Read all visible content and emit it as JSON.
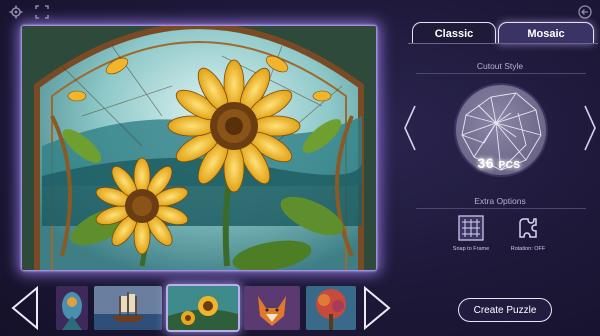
{
  "top_bar": {
    "settings_icon": "gear-icon",
    "fullscreen_icon": "fullscreen-icon",
    "back_icon": "back-arrow-icon"
  },
  "puzzle_preview": {
    "image_subject": "stained-glass-sunflowers"
  },
  "mode_tabs": [
    {
      "label": "Classic",
      "selected": false
    },
    {
      "label": "Mosaic",
      "selected": true
    }
  ],
  "cutout": {
    "section_label": "Cutout Style",
    "piece_count": "36",
    "piece_unit": "PCS",
    "prev_icon": "chevron-left-icon",
    "next_icon": "chevron-right-icon"
  },
  "extra_options": {
    "section_label": "Extra Options",
    "items": [
      {
        "label": "Snap to Frame",
        "icon": "grid-icon"
      },
      {
        "label": "Rotation: OFF",
        "icon": "rotation-icon"
      }
    ]
  },
  "create_button_label": "Create Puzzle",
  "thumbnails": [
    {
      "subject": "dragon"
    },
    {
      "subject": "ship"
    },
    {
      "subject": "sunflowers",
      "selected": true
    },
    {
      "subject": "fox"
    },
    {
      "subject": "tree"
    }
  ],
  "colors": {
    "accent_glow": "#b9aef0",
    "background": "#1d1838"
  }
}
